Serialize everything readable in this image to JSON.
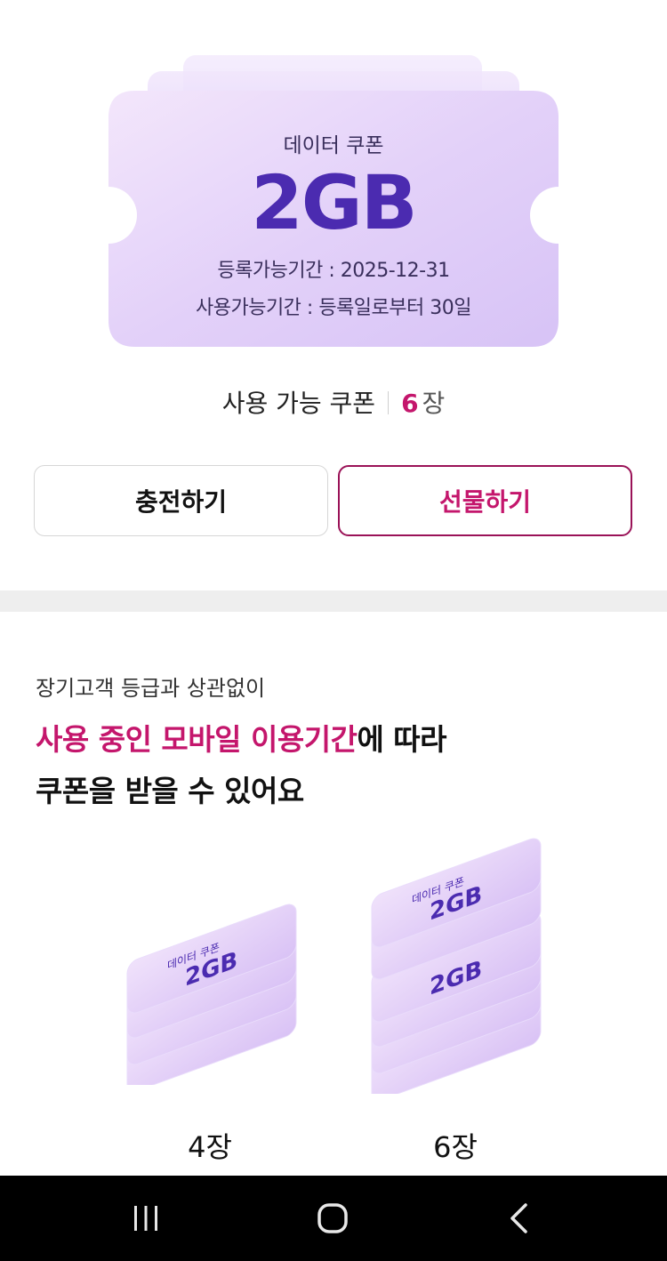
{
  "coupon": {
    "label": "데이터 쿠폰",
    "amount": "2GB",
    "register_period": "등록가능기간 : 2025-12-31",
    "use_period": "사용가능기간 : 등록일로부터 30일"
  },
  "coupon_count": {
    "label": "사용 가능 쿠폰",
    "number": "6",
    "unit": "장"
  },
  "actions": {
    "charge_label": "충전하기",
    "gift_label": "선물하기"
  },
  "info": {
    "subtitle": "장기고객 등급과 상관없이",
    "title_highlight": "사용 중인 모바일 이용기간",
    "title_rest": "에 따라",
    "title_line2": "쿠폰을 받을 수 있어요"
  },
  "stacks": [
    {
      "label": "4장",
      "count": 4,
      "card_label": "데이터 쿠폰",
      "card_amount": "2GB"
    },
    {
      "label": "6장",
      "count": 6,
      "card_label": "데이터 쿠폰",
      "card_amount": "2GB"
    }
  ],
  "navbar": {
    "icons": [
      "recent-apps-icon",
      "home-icon",
      "back-icon"
    ]
  },
  "colors": {
    "accent": "#c4166c",
    "coupon_text": "#4b2bb0",
    "coupon_bg": "#e6d6fb"
  }
}
